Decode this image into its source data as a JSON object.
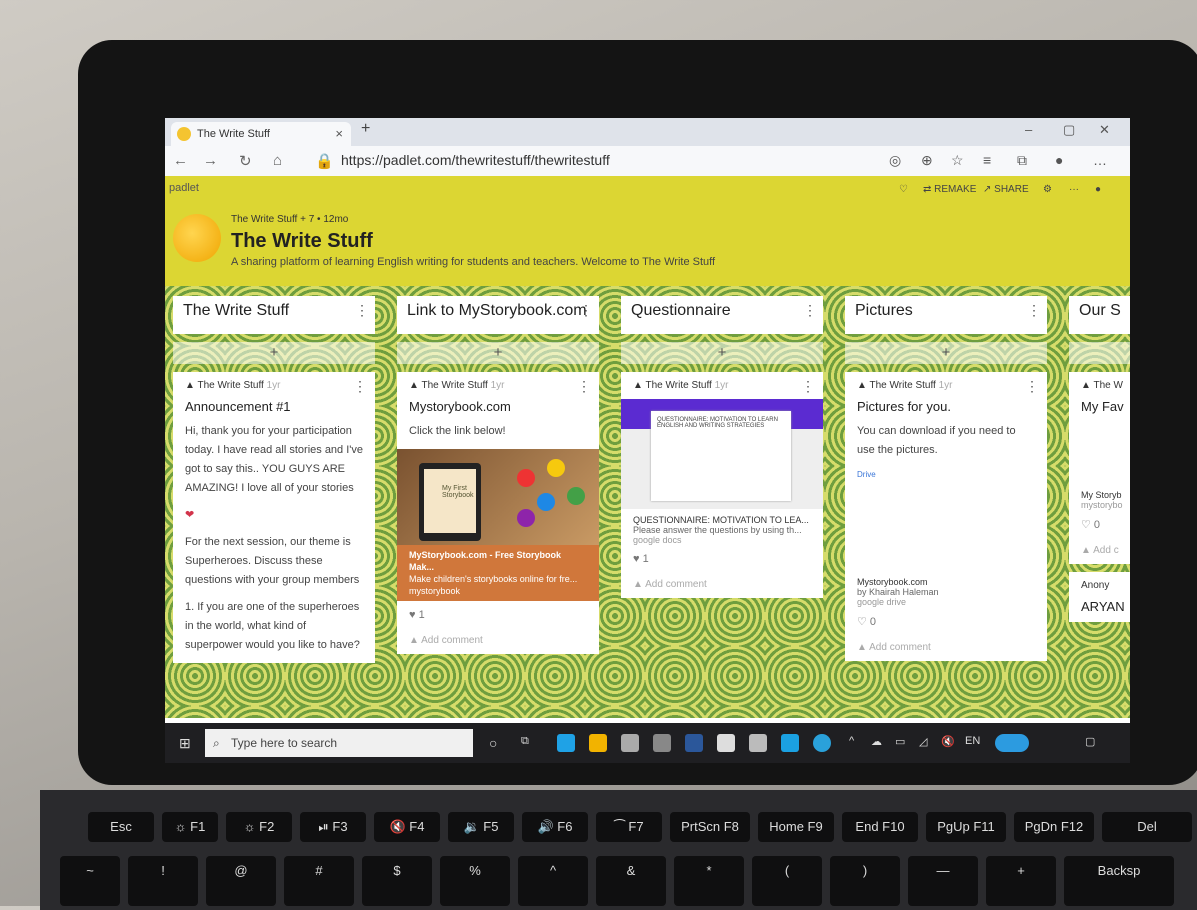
{
  "browser": {
    "tab_title": "The Write Stuff",
    "tab_close": "×",
    "new_tab": "+",
    "url": "https://padlet.com/thewritestuff/thewritestuff",
    "window_controls": [
      "–",
      "▢",
      "✕"
    ]
  },
  "padlet": {
    "logo": "padlet",
    "actions": {
      "remake": "⇄ REMAKE",
      "share": "↗ SHARE",
      "more": "···"
    },
    "meta": "The Write Stuff + 7 • 12mo",
    "title": "The Write Stuff",
    "subtitle": "A sharing platform of learning English writing for students and teachers. Welcome to The Write Stuff"
  },
  "columns": [
    {
      "heading": "The Write Stuff",
      "author": "The Write Stuff",
      "age": "1yr",
      "card_title": "Announcement #1",
      "text1": "Hi, thank you for your participation today. I have read all stories and I've got to say this.. YOU GUYS ARE AMAZING! I love all of your stories",
      "text2": "For the next session, our theme is Superheroes. Discuss these questions with your group members",
      "text3": "1. If you are one of the superheroes in the world, what kind of superpower would you like to have?"
    },
    {
      "heading": "Link to MyStorybook.com",
      "author": "The Write Stuff",
      "age": "1yr",
      "card_title": "Mystorybook.com",
      "text1": "Click the link below!",
      "book_line1": "My First",
      "book_line2": "Storybook",
      "link_title": "MyStorybook.com - Free Storybook Mak...",
      "link_desc": "Make children's storybooks online for fre...",
      "link_src": "mystorybook",
      "likes": "1",
      "comment": "Add comment"
    },
    {
      "heading": "Questionnaire",
      "author": "The Write Stuff",
      "age": "1yr",
      "doc_heading": "QUESTIONNAIRE: MOTIVATION TO LEARN ENGLISH AND WRITING STRATEGIES",
      "g_title": "QUESTIONNAIRE: MOTIVATION TO LEA...",
      "g_desc": "Please answer the questions by using th...",
      "g_src": "google docs",
      "likes": "1",
      "comment": "Add comment"
    },
    {
      "heading": "Pictures",
      "author": "The Write Stuff",
      "age": "1yr",
      "card_title": "Pictures for you.",
      "text1": "You can download if you need to use the pictures.",
      "drive": "Drive",
      "g_title": "Mystorybook.com",
      "g_desc": "by Khairah Haleman",
      "g_src": "google drive",
      "likes": "0",
      "comment": "Add comment"
    },
    {
      "heading": "Our S",
      "author": "The W",
      "card_title": "My Fav",
      "g_title": "My Storyb",
      "g_src": "mystorybo",
      "likes": "0",
      "comment": "Add c",
      "author2": "Anony",
      "name2": "ARYAN"
    }
  ],
  "add_symbol": "+",
  "taskbar": {
    "search_placeholder": "Type here to search"
  },
  "keyboard": {
    "row1": [
      "Esc",
      "☼ F1",
      "☼ F2",
      "⏯ F3",
      "🔇 F4",
      "🔉 F5",
      "🔊 F6",
      "⁀ F7",
      "PrtScn F8",
      "Home F9",
      "End F10",
      "PgUp F11",
      "PgDn F12",
      "Del"
    ],
    "row2": [
      "~",
      "!",
      "@",
      "#",
      "$",
      "%",
      "^",
      "&",
      "*",
      "(",
      ")",
      "—",
      "+",
      "Backsp"
    ]
  }
}
